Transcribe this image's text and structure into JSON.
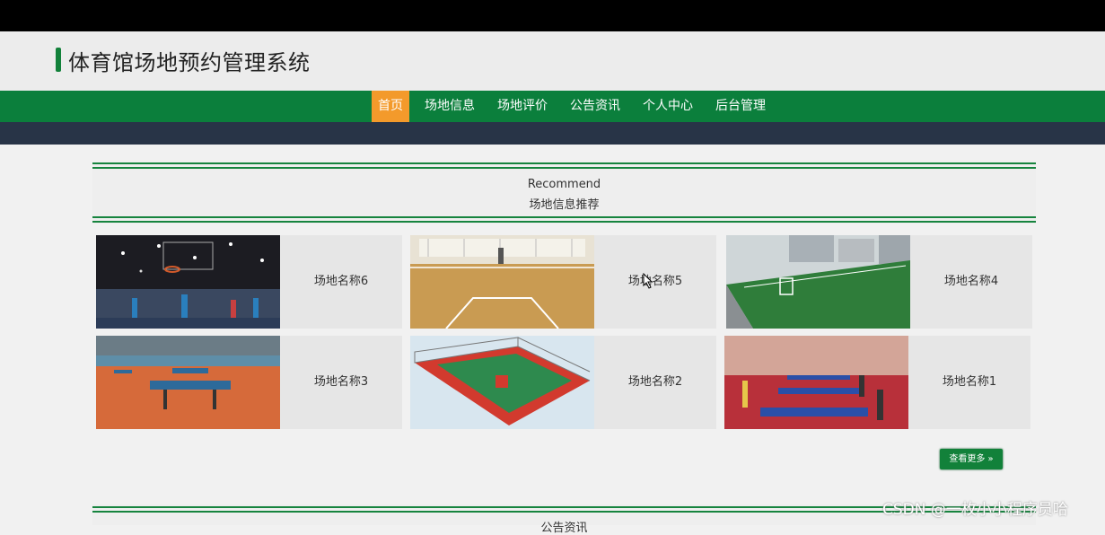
{
  "app": {
    "title": "体育馆场地预约管理系统"
  },
  "nav": {
    "items": [
      {
        "label": "首页",
        "active": true
      },
      {
        "label": "场地信息",
        "active": false
      },
      {
        "label": "场地评价",
        "active": false
      },
      {
        "label": "公告资讯",
        "active": false
      },
      {
        "label": "个人中心",
        "active": false
      },
      {
        "label": "后台管理",
        "active": false
      }
    ]
  },
  "recommend": {
    "title_en": "Recommend",
    "title_cn": "场地信息推荐",
    "venues": [
      {
        "name": "场地名称6",
        "image": "basketball-court-photo"
      },
      {
        "name": "场地名称5",
        "image": "wood-floor-gym-photo"
      },
      {
        "name": "场地名称4",
        "image": "football-field-photo"
      },
      {
        "name": "场地名称3",
        "image": "table-tennis-hall-photo"
      },
      {
        "name": "场地名称2",
        "image": "outdoor-court-render"
      },
      {
        "name": "场地名称1",
        "image": "table-tennis-room-photo"
      }
    ],
    "more_button": "查看更多 »"
  },
  "next_section": {
    "title": "公告资讯"
  },
  "watermark": "CSDN @一枚小小程序员哈",
  "colors": {
    "nav_green": "#0b7f3c",
    "active_orange": "#f39a2b",
    "dark_strip": "#283447",
    "accent_green": "#12813a"
  }
}
